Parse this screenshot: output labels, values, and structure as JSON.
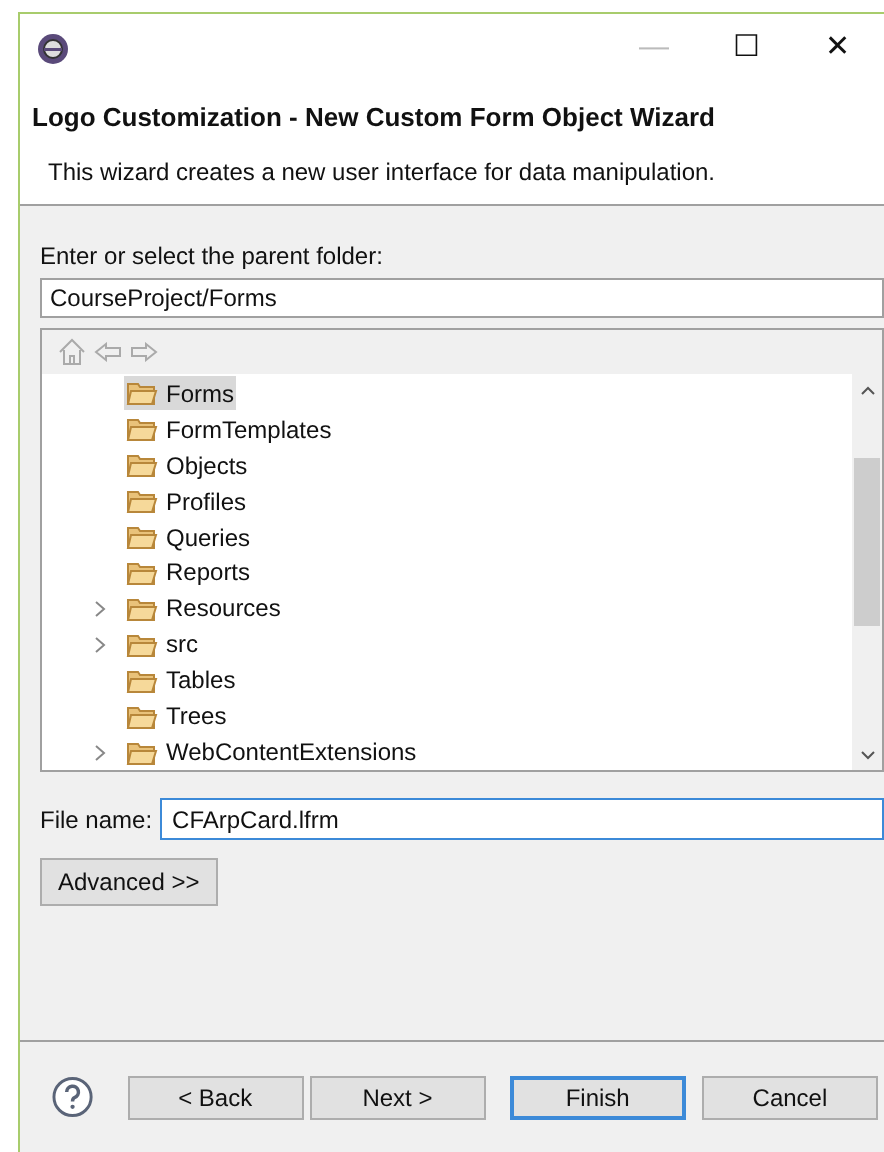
{
  "window": {
    "controls": [
      "—",
      "☐",
      "✕"
    ]
  },
  "header": {
    "title": "Logo Customization - New Custom Form Object Wizard",
    "description": "This wizard creates a new user interface for data manipulation."
  },
  "parent_folder": {
    "label": "Enter or select the parent folder:",
    "value": "CourseProject/Forms"
  },
  "tree": {
    "items": [
      {
        "label": "Forms",
        "expandable": false,
        "selected": true
      },
      {
        "label": "FormTemplates",
        "expandable": false,
        "selected": false
      },
      {
        "label": "Objects",
        "expandable": false,
        "selected": false
      },
      {
        "label": "Profiles",
        "expandable": false,
        "selected": false
      },
      {
        "label": "Queries",
        "expandable": false,
        "selected": false
      },
      {
        "label": "Reports",
        "expandable": false,
        "selected": false
      },
      {
        "label": "Resources",
        "expandable": true,
        "selected": false
      },
      {
        "label": "src",
        "expandable": true,
        "selected": false
      },
      {
        "label": "Tables",
        "expandable": false,
        "selected": false
      },
      {
        "label": "Trees",
        "expandable": false,
        "selected": false
      },
      {
        "label": "WebContentExtensions",
        "expandable": true,
        "selected": false
      }
    ]
  },
  "file_name": {
    "label": "File name:",
    "value": "CFArpCard.lfrm"
  },
  "advanced_button": "Advanced >>",
  "buttons": [
    {
      "label": "< Back",
      "default": false
    },
    {
      "label": "Next >",
      "default": false
    },
    {
      "label": "Finish",
      "default": true
    },
    {
      "label": "Cancel",
      "default": false
    }
  ]
}
